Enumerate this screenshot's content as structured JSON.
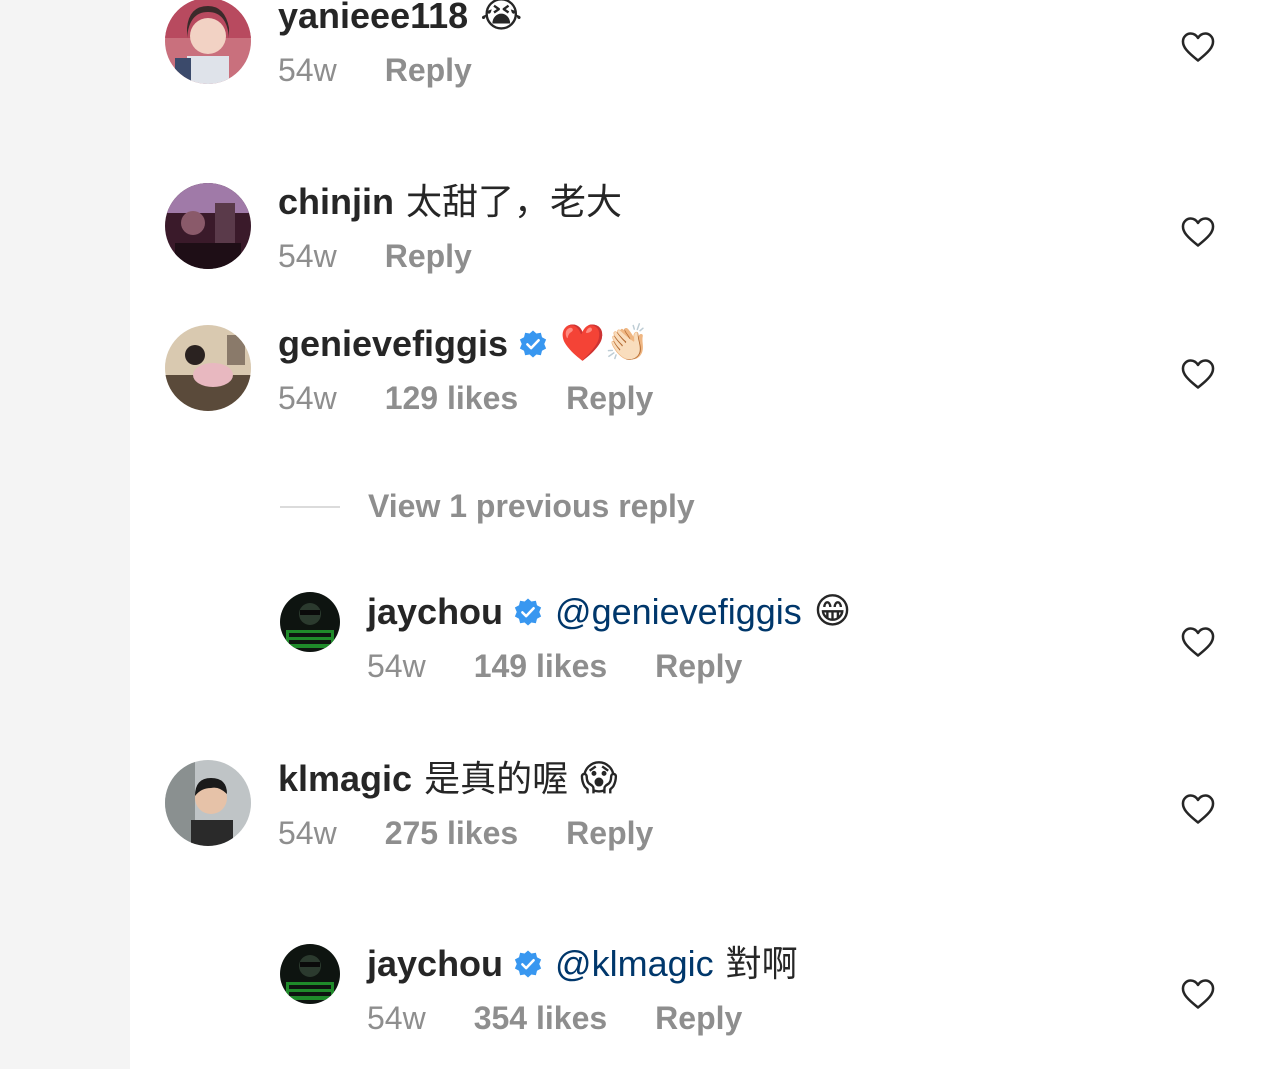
{
  "comments": [
    {
      "username": "yanieee118",
      "verified": false,
      "text": "",
      "emoji": "😭",
      "time": "54w",
      "likes": "",
      "reply": "Reply",
      "avatar_icon": "avatar-girl-photo"
    },
    {
      "username": "chinjin",
      "verified": false,
      "text": "太甜了，老大",
      "emoji": "",
      "time": "54w",
      "likes": "",
      "reply": "Reply",
      "avatar_icon": "avatar-stage-photo"
    },
    {
      "username": "genievefiggis",
      "verified": true,
      "text": "",
      "emoji": "❤️👏🏻",
      "time": "54w",
      "likes": "129 likes",
      "reply": "Reply",
      "avatar_icon": "avatar-painting-photo"
    },
    {
      "username": "jaychou",
      "verified": true,
      "mention": "@genievefiggis",
      "text": "",
      "emoji": "😁",
      "time": "54w",
      "likes": "149 likes",
      "reply": "Reply",
      "avatar_icon": "avatar-green-hornet"
    },
    {
      "username": "klmagic",
      "verified": false,
      "text": "是真的喔",
      "emoji": "😱",
      "time": "54w",
      "likes": "275 likes",
      "reply": "Reply",
      "avatar_icon": "avatar-man-photo"
    },
    {
      "username": "jaychou",
      "verified": true,
      "mention": "@klmagic",
      "text": "對啊",
      "emoji": "",
      "time": "54w",
      "likes": "354 likes",
      "reply": "Reply",
      "avatar_icon": "avatar-green-hornet"
    }
  ],
  "view_previous": "View 1 previous reply",
  "colors": {
    "verified_blue": "#3897f0",
    "mention_blue": "#00376b",
    "meta_gray": "#8e8e8e"
  }
}
